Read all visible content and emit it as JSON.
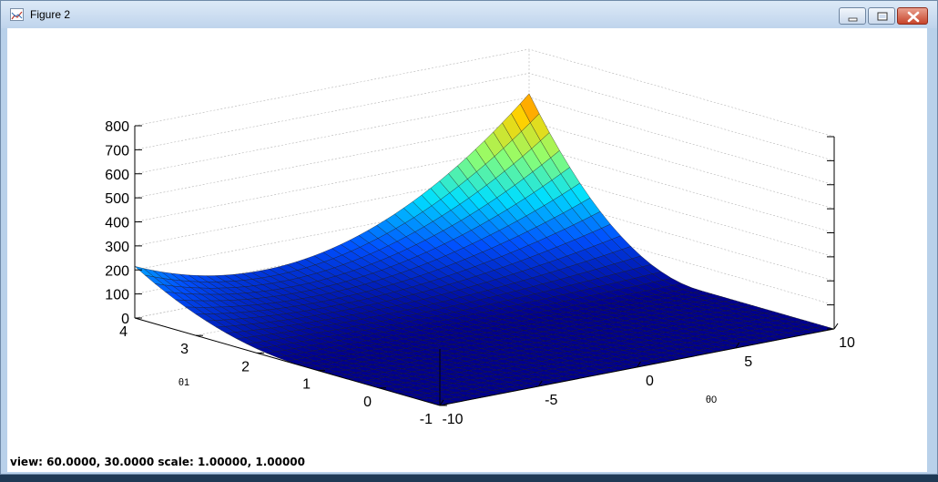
{
  "window": {
    "title": "Figure 2"
  },
  "status": {
    "text": "view:  60.0000,  30.0000   scale:  1.00000,  1.00000"
  },
  "chart_data": {
    "type": "surface",
    "title": "",
    "xlabel": "θ0",
    "ylabel": "θ1",
    "zlabel": "",
    "x_ticks": [
      "-10",
      "-5",
      "0",
      "5",
      "10"
    ],
    "y_ticks": [
      "-1",
      "0",
      "1",
      "2",
      "3",
      "4"
    ],
    "z_ticks": [
      "0",
      "100",
      "200",
      "300",
      "400",
      "500",
      "600",
      "700",
      "800"
    ],
    "x_range": [
      -10,
      10
    ],
    "y_range": [
      -1,
      4
    ],
    "z_range": [
      0,
      800
    ],
    "view": {
      "azimuth": 60,
      "elevation": 30
    },
    "colormap": [
      "#00008f",
      "#0050ff",
      "#00dfff",
      "#8fff70",
      "#ffd000",
      "#ff3000",
      "#800000"
    ],
    "grid": true,
    "corner_values": [
      {
        "x": -10,
        "y": -1,
        "z": 30
      },
      {
        "x": -10,
        "y": 4,
        "z": 200
      },
      {
        "x": 10,
        "y": -1,
        "z": 0
      },
      {
        "x": 10,
        "y": 4,
        "z": 795
      }
    ]
  }
}
